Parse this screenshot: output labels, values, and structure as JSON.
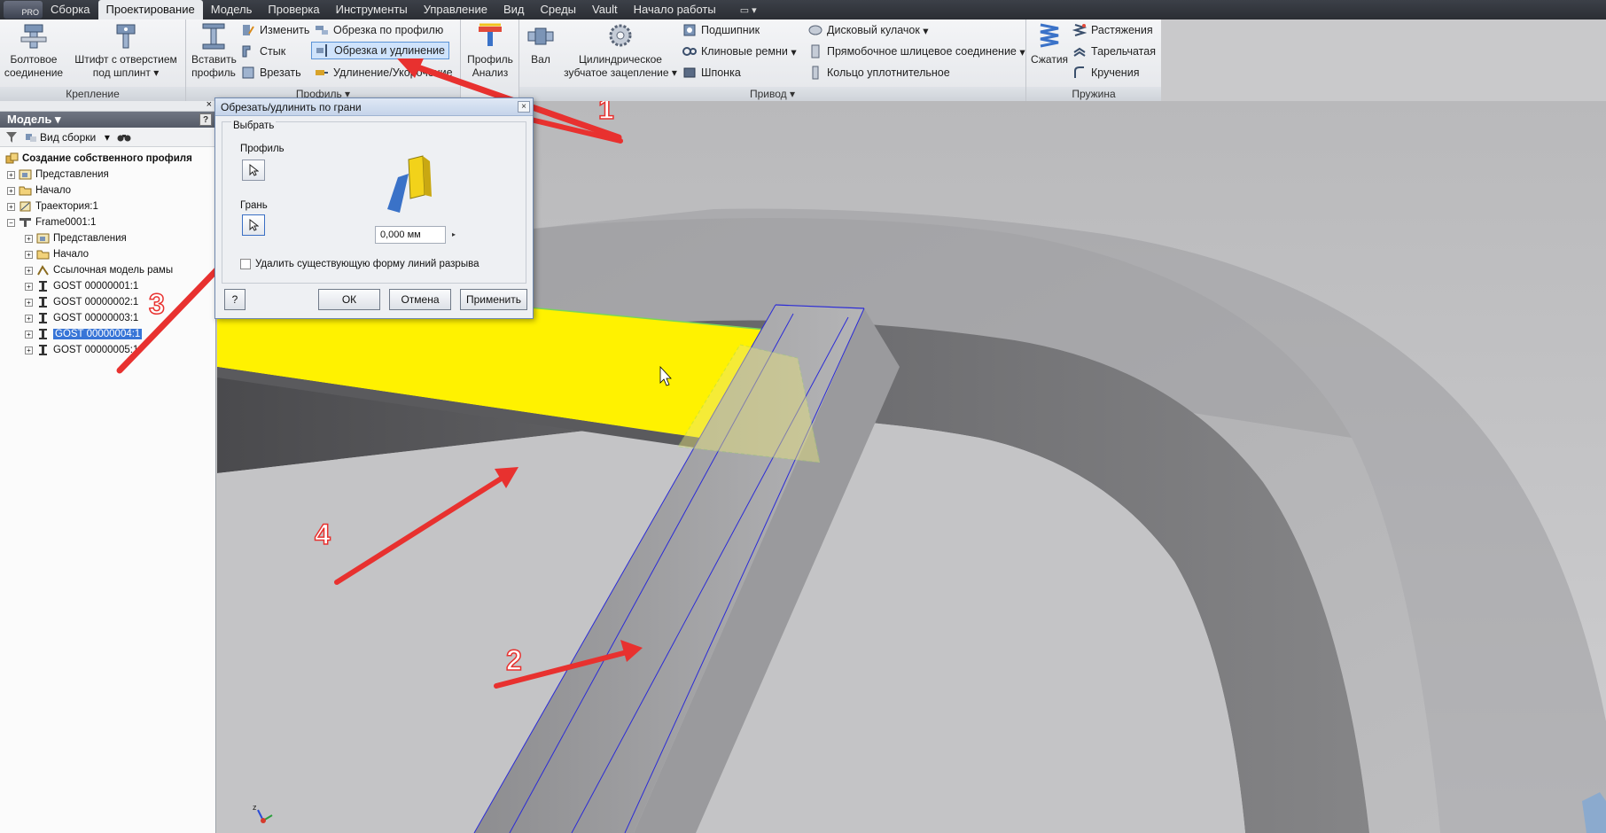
{
  "menu": {
    "pro_label": "PRO",
    "tabs": [
      "Сборка",
      "Проектирование",
      "Модель",
      "Проверка",
      "Инструменты",
      "Управление",
      "Вид",
      "Среды",
      "Vault",
      "Начало работы"
    ],
    "active_tab": "Проектирование"
  },
  "ribbon": {
    "krepleniye": {
      "title": "Крепление",
      "bolt_line1": "Болтовое",
      "bolt_line2": "соединение",
      "pin_line1": "Штифт с отверстием",
      "pin_line2": "под шплинт"
    },
    "profil": {
      "title": "Профиль",
      "insert_line1": "Вставить",
      "insert_line2": "профиль",
      "change": "Изменить",
      "joint": "Стык",
      "cut_in": "Врезать",
      "trim_profile": "Обрезка по профилю",
      "trim_extend": "Обрезка и удлинение",
      "lengthen": "Удлинение/Укорочение"
    },
    "analysis": {
      "line1": "Профиль",
      "line2": "Анализ"
    },
    "privod": {
      "title": "Привод",
      "shaft": "Вал",
      "gear_line1": "Цилиндрическое",
      "gear_line2": "зубчатое зацепление",
      "bearing": "Подшипник",
      "vbelts": "Клиновые ремни",
      "key": "Шпонка",
      "cam": "Дисковый кулачок",
      "spline": "Прямобочное шлицевое соединение",
      "oring": "Кольцо уплотнительное"
    },
    "pruzhina": {
      "title": "Пружина",
      "compression": "Сжатия",
      "tension": "Растяжения",
      "disc": "Тарельчатая",
      "torsion": "Кручения"
    }
  },
  "browser": {
    "title": "Модель",
    "view_label": "Вид сборки",
    "items": [
      {
        "label": "Создание собственного профиля",
        "level": 0
      },
      {
        "label": "Представления",
        "level": 1
      },
      {
        "label": "Начало",
        "level": 1
      },
      {
        "label": "Траектория:1",
        "level": 1
      },
      {
        "label": "Frame0001:1",
        "level": 1
      },
      {
        "label": "Представления",
        "level": 2
      },
      {
        "label": "Начало",
        "level": 2
      },
      {
        "label": "Ссылочная модель рамы",
        "level": 2
      },
      {
        "label": "GOST  00000001:1",
        "level": 2
      },
      {
        "label": "GOST  00000002:1",
        "level": 2
      },
      {
        "label": "GOST  00000003:1",
        "level": 2
      },
      {
        "label": "GOST  00000004:1",
        "level": 2
      },
      {
        "label": "GOST  00000005:1",
        "level": 2
      }
    ]
  },
  "dialog": {
    "title": "Обрезать/удлинить по грани",
    "group_label": "Выбрать",
    "profile_label": "Профиль",
    "face_label": "Грань",
    "offset_value": "0,000 мм",
    "checkbox_label": "Удалить существующую форму линий разрыва",
    "ok": "ОК",
    "cancel": "Отмена",
    "apply": "Применить",
    "help": "?"
  },
  "annotations": [
    "1",
    "2",
    "3",
    "4"
  ],
  "colors": {
    "highlight_face": "#fff200",
    "arrow": "#e8312f",
    "edge_blue": "#2b2bd6"
  }
}
